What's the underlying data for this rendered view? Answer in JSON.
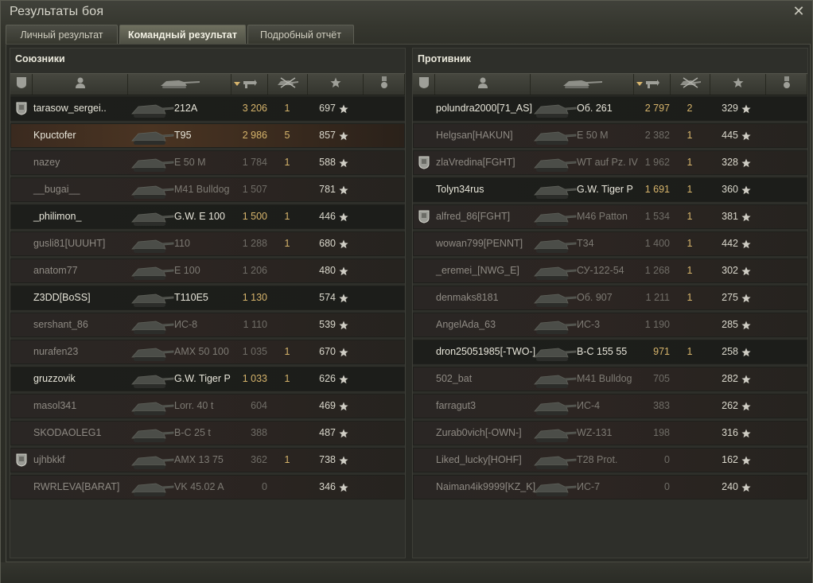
{
  "window": {
    "title": "Результаты боя",
    "close_icon": "close-icon"
  },
  "tabs": [
    {
      "label": "Личный результат",
      "active": false
    },
    {
      "label": "Командный результат",
      "active": true
    },
    {
      "label": "Подробный отчёт",
      "active": false
    }
  ],
  "columns": [
    "badge-icon",
    "player-icon",
    "tank-icon",
    "damage-icon",
    "kills-icon",
    "star-icon",
    "medal-icon"
  ],
  "allies": {
    "title": "Союзники",
    "rows": [
      {
        "badge": true,
        "state": "alive",
        "player": "tarasow_sergei..",
        "tank": "212A",
        "damage": "3 206",
        "kills": "1",
        "xp": "697"
      },
      {
        "badge": false,
        "state": "self",
        "player": "Kpuctofer",
        "tank": "T95",
        "damage": "2 986",
        "kills": "5",
        "xp": "857"
      },
      {
        "badge": false,
        "state": "dead",
        "player": "nazey",
        "tank": "E 50 M",
        "damage": "1 784",
        "kills": "1",
        "xp": "588"
      },
      {
        "badge": false,
        "state": "dead",
        "player": "__bugai__",
        "tank": "M41 Bulldog",
        "damage": "1 507",
        "kills": "",
        "xp": "781"
      },
      {
        "badge": false,
        "state": "alive",
        "player": "_philimon_",
        "tank": "G.W. E 100",
        "damage": "1 500",
        "kills": "1",
        "xp": "446"
      },
      {
        "badge": false,
        "state": "dead",
        "player": "gusli81[UUUHT]",
        "tank": "110",
        "damage": "1 288",
        "kills": "1",
        "xp": "680"
      },
      {
        "badge": false,
        "state": "dead",
        "player": "anatom77",
        "tank": "E 100",
        "damage": "1 206",
        "kills": "",
        "xp": "480"
      },
      {
        "badge": false,
        "state": "alive",
        "player": "Z3DD[BoSS]",
        "tank": "T110E5",
        "damage": "1 130",
        "kills": "",
        "xp": "574"
      },
      {
        "badge": false,
        "state": "dead",
        "player": "sershant_86",
        "tank": "ИС-8",
        "damage": "1 110",
        "kills": "",
        "xp": "539"
      },
      {
        "badge": false,
        "state": "dead",
        "player": "nurafen23",
        "tank": "AMX 50 100",
        "damage": "1 035",
        "kills": "1",
        "xp": "670"
      },
      {
        "badge": false,
        "state": "alive",
        "player": "gruzzovik",
        "tank": "G.W. Tiger P",
        "damage": "1 033",
        "kills": "1",
        "xp": "626"
      },
      {
        "badge": false,
        "state": "dead",
        "player": "masol341",
        "tank": "Lorr. 40 t",
        "damage": "604",
        "kills": "",
        "xp": "469"
      },
      {
        "badge": false,
        "state": "dead",
        "player": "SKODAOLEG1",
        "tank": "В-С 25 t",
        "damage": "388",
        "kills": "",
        "xp": "487"
      },
      {
        "badge": true,
        "state": "dead",
        "player": "ujhbkkf",
        "tank": "AMX 13 75",
        "damage": "362",
        "kills": "1",
        "xp": "738"
      },
      {
        "badge": false,
        "state": "dead",
        "player": "RWRLEVA[BARAT]",
        "tank": "VK 45.02 A",
        "damage": "0",
        "kills": "",
        "xp": "346"
      }
    ]
  },
  "enemies": {
    "title": "Противник",
    "rows": [
      {
        "badge": false,
        "state": "alive",
        "player": "polundra2000[71_AS]",
        "tank": "Об. 261",
        "damage": "2 797",
        "kills": "2",
        "xp": "329"
      },
      {
        "badge": false,
        "state": "dead",
        "player": "Helgsan[HAKUN]",
        "tank": "E 50 M",
        "damage": "2 382",
        "kills": "1",
        "xp": "445"
      },
      {
        "badge": true,
        "state": "dead",
        "player": "zlaVredina[FGHT]",
        "tank": "WT auf Pz. IV",
        "damage": "1 962",
        "kills": "1",
        "xp": "328"
      },
      {
        "badge": false,
        "state": "alive",
        "player": "Tolyn34rus",
        "tank": "G.W. Tiger P",
        "damage": "1 691",
        "kills": "1",
        "xp": "360"
      },
      {
        "badge": true,
        "state": "dead",
        "player": "alfred_86[FGHT]",
        "tank": "M46 Patton",
        "damage": "1 534",
        "kills": "1",
        "xp": "381"
      },
      {
        "badge": false,
        "state": "dead",
        "player": "wowan799[PENNT]",
        "tank": "T34",
        "damage": "1 400",
        "kills": "1",
        "xp": "442"
      },
      {
        "badge": false,
        "state": "dead",
        "player": "_eremei_[NWG_E]",
        "tank": "СУ-122-54",
        "damage": "1 268",
        "kills": "1",
        "xp": "302"
      },
      {
        "badge": false,
        "state": "dead",
        "player": "denmaks8181",
        "tank": "Об. 907",
        "damage": "1 211",
        "kills": "1",
        "xp": "275"
      },
      {
        "badge": false,
        "state": "dead",
        "player": "AngelAda_63",
        "tank": "ИС-3",
        "damage": "1 190",
        "kills": "",
        "xp": "285"
      },
      {
        "badge": false,
        "state": "alive",
        "player": "dron25051985[-TWO-]",
        "tank": "В-С 155 55",
        "damage": "971",
        "kills": "1",
        "xp": "258"
      },
      {
        "badge": false,
        "state": "dead",
        "player": "502_bat",
        "tank": "M41 Bulldog",
        "damage": "705",
        "kills": "",
        "xp": "282"
      },
      {
        "badge": false,
        "state": "dead",
        "player": "farragut3",
        "tank": "ИС-4",
        "damage": "383",
        "kills": "",
        "xp": "262"
      },
      {
        "badge": false,
        "state": "dead",
        "player": "Zurab0vich[-OWN-]",
        "tank": "WZ-131",
        "damage": "198",
        "kills": "",
        "xp": "316"
      },
      {
        "badge": false,
        "state": "dead",
        "player": "Liked_lucky[HOHF]",
        "tank": "T28 Prot.",
        "damage": "0",
        "kills": "",
        "xp": "162"
      },
      {
        "badge": false,
        "state": "dead",
        "player": "Naiman4ik9999[KZ_K]",
        "tank": "ИС-7",
        "damage": "0",
        "kills": "",
        "xp": "240"
      }
    ]
  },
  "colors": {
    "alive_text": "#e8e6da",
    "dead_text": "#8e8a83",
    "damage_gold": "#d6b46b",
    "self_row": "#4a3422"
  }
}
